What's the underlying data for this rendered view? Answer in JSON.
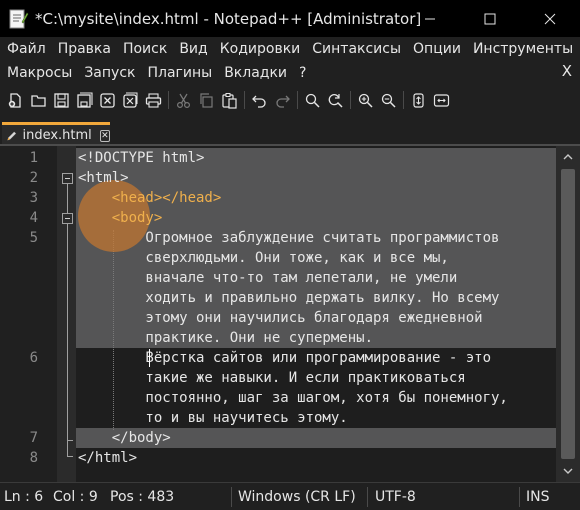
{
  "window": {
    "title": "*C:\\mysite\\index.html - Notepad++ [Administrator]",
    "controls": [
      "minimize",
      "maximize",
      "close"
    ]
  },
  "menu": {
    "row1": [
      "Файл",
      "Правка",
      "Поиск",
      "Вид",
      "Кодировки",
      "Синтаксисы",
      "Опции",
      "Инструменты"
    ],
    "row2": [
      "Макросы",
      "Запуск",
      "Плагины",
      "Вкладки",
      "?"
    ],
    "close_glyph": "X"
  },
  "toolbar": {
    "buttons": [
      "new-file-icon",
      "open-file-icon",
      "save-icon",
      "save-all-icon",
      "close-icon",
      "close-all-icon",
      "print-icon",
      "cut-icon",
      "copy-icon",
      "paste-icon",
      "undo-icon",
      "redo-icon",
      "find-icon",
      "replace-icon",
      "zoom-in-icon",
      "zoom-out-icon",
      "sync-scroll-icon",
      "wrap-icon"
    ]
  },
  "tab": {
    "label": "index.html",
    "close_glyph": "✕"
  },
  "editor": {
    "line_numbers": [
      "1",
      "2",
      "3",
      "4",
      "5",
      "6",
      "7",
      "8"
    ],
    "lines": [
      "<!DOCTYPE html>",
      "<html>",
      "    <head></head>",
      "    <body>",
      "        Огромное заблуждение считать программистов",
      "        сверхлюдьми. Они тоже, как и все мы,",
      "        вначале что-то там лепетали, не умели",
      "        ходить и правильно держать вилку. Но всему",
      "        этому они научились благодаря ежедневной",
      "        практике. Они не супермены.",
      "        Вёрстка сайтов или программирование - это",
      "        такие же навыки. И если практиковаться",
      "        постоянно, шаг за шагом, хотя бы понемногу,",
      "        то и вы научитесь этому.",
      "    </body>",
      "</html>"
    ],
    "colors": {
      "selection": "#555556",
      "tag": "#f0b04c",
      "text": "#e6e6e6",
      "accent": "#f2a83b",
      "click": "#d67c2a"
    }
  },
  "status": {
    "line": "Ln : 6",
    "col": "Col : 9",
    "pos": "Pos : 483",
    "eol": "Windows (CR LF)",
    "encoding": "UTF-8",
    "mode": "INS"
  }
}
